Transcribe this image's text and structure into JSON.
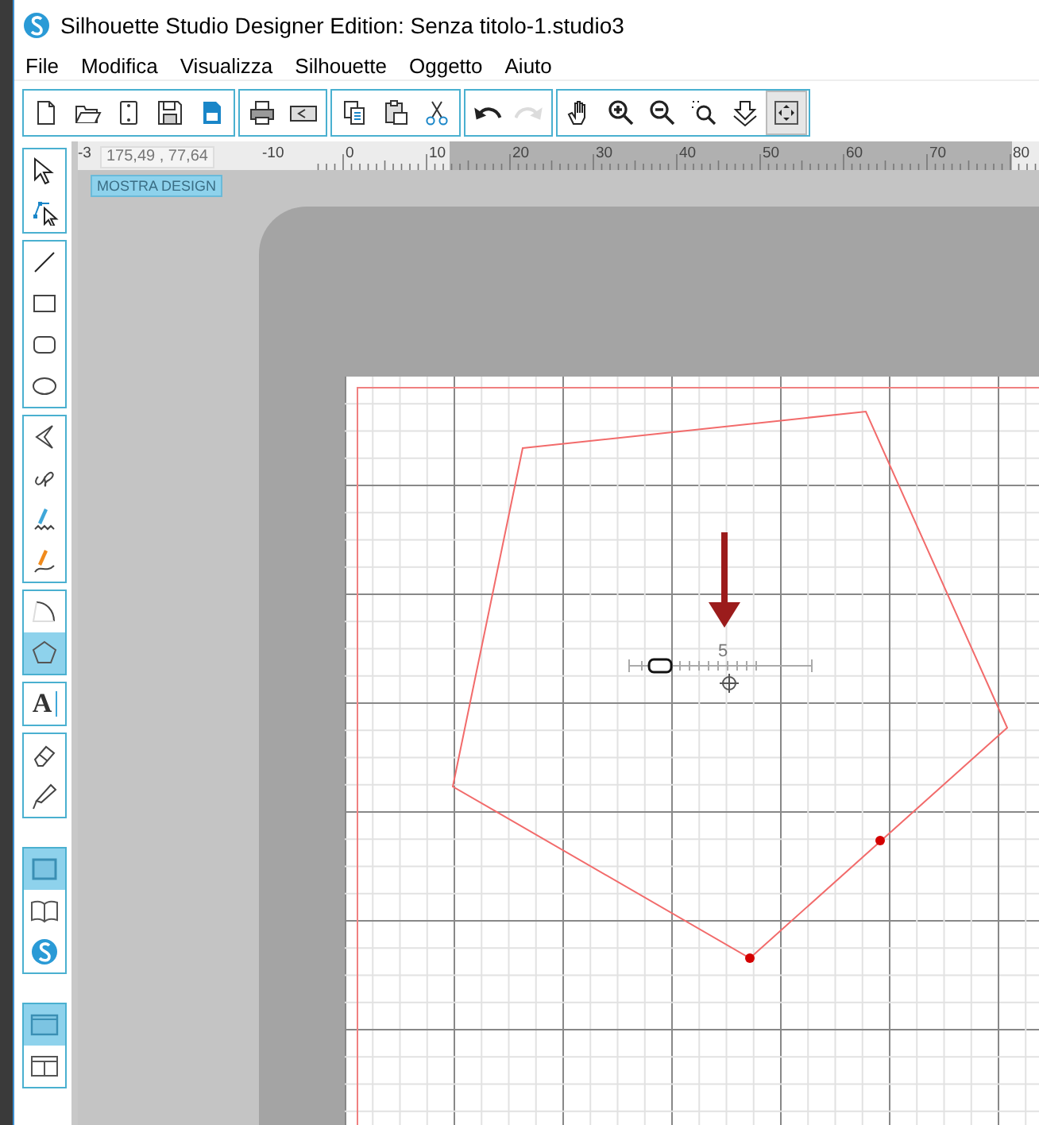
{
  "window": {
    "title": "Silhouette Studio Designer Edition: Senza titolo-1.studio3"
  },
  "menu": [
    "File",
    "Modifica",
    "Visualizza",
    "Silhouette",
    "Oggetto",
    "Aiuto"
  ],
  "toolbar": [
    [
      {
        "disabled": false,
        "selected": false
      },
      {
        "disabled": false,
        "selected": false
      },
      {
        "disabled": false,
        "selected": false
      },
      {
        "disabled": false,
        "selected": false
      },
      {
        "disabled": false,
        "selected": false
      }
    ],
    [
      {
        "disabled": false,
        "selected": false
      },
      {
        "disabled": false,
        "selected": false
      }
    ],
    [
      {
        "disabled": false,
        "selected": false
      },
      {
        "disabled": false,
        "selected": false
      },
      {
        "disabled": false,
        "selected": false
      }
    ],
    [
      {
        "disabled": false,
        "selected": false
      },
      {
        "disabled": true,
        "selected": false
      }
    ],
    [
      {
        "disabled": false,
        "selected": false
      },
      {
        "disabled": false,
        "selected": false
      },
      {
        "disabled": false,
        "selected": false
      },
      {
        "disabled": false,
        "selected": false
      },
      {
        "disabled": false,
        "selected": false
      },
      {
        "disabled": false,
        "selected": true
      }
    ]
  ],
  "tools": [
    [
      {
        "selected": false
      },
      {
        "selected": false
      }
    ],
    [
      {
        "selected": false
      },
      {
        "selected": false
      },
      {
        "selected": false
      },
      {
        "selected": false
      }
    ],
    [
      {
        "selected": false
      },
      {
        "selected": false
      },
      {
        "selected": false
      },
      {
        "selected": false
      }
    ],
    [
      {
        "selected": false
      },
      {
        "selected": true
      }
    ],
    [
      {
        "selected": false,
        "glyph": "A"
      }
    ],
    [
      {
        "selected": false
      },
      {
        "selected": false
      }
    ],
    [
      {
        "selected": true
      },
      {
        "selected": false
      },
      {
        "selected": false
      }
    ],
    [
      {
        "selected": true
      },
      {
        "selected": false
      }
    ]
  ],
  "ruler": {
    "labels": [
      "-3",
      "-10",
      "0",
      "10",
      "20",
      "30",
      "40",
      "50",
      "60",
      "70",
      "80"
    ]
  },
  "coordinates": "175,49 , 77,64",
  "show_design_button": "MOSTRA DESIGN",
  "canvas": {
    "sides_slider": {
      "value": "5",
      "level": 0.17
    }
  }
}
